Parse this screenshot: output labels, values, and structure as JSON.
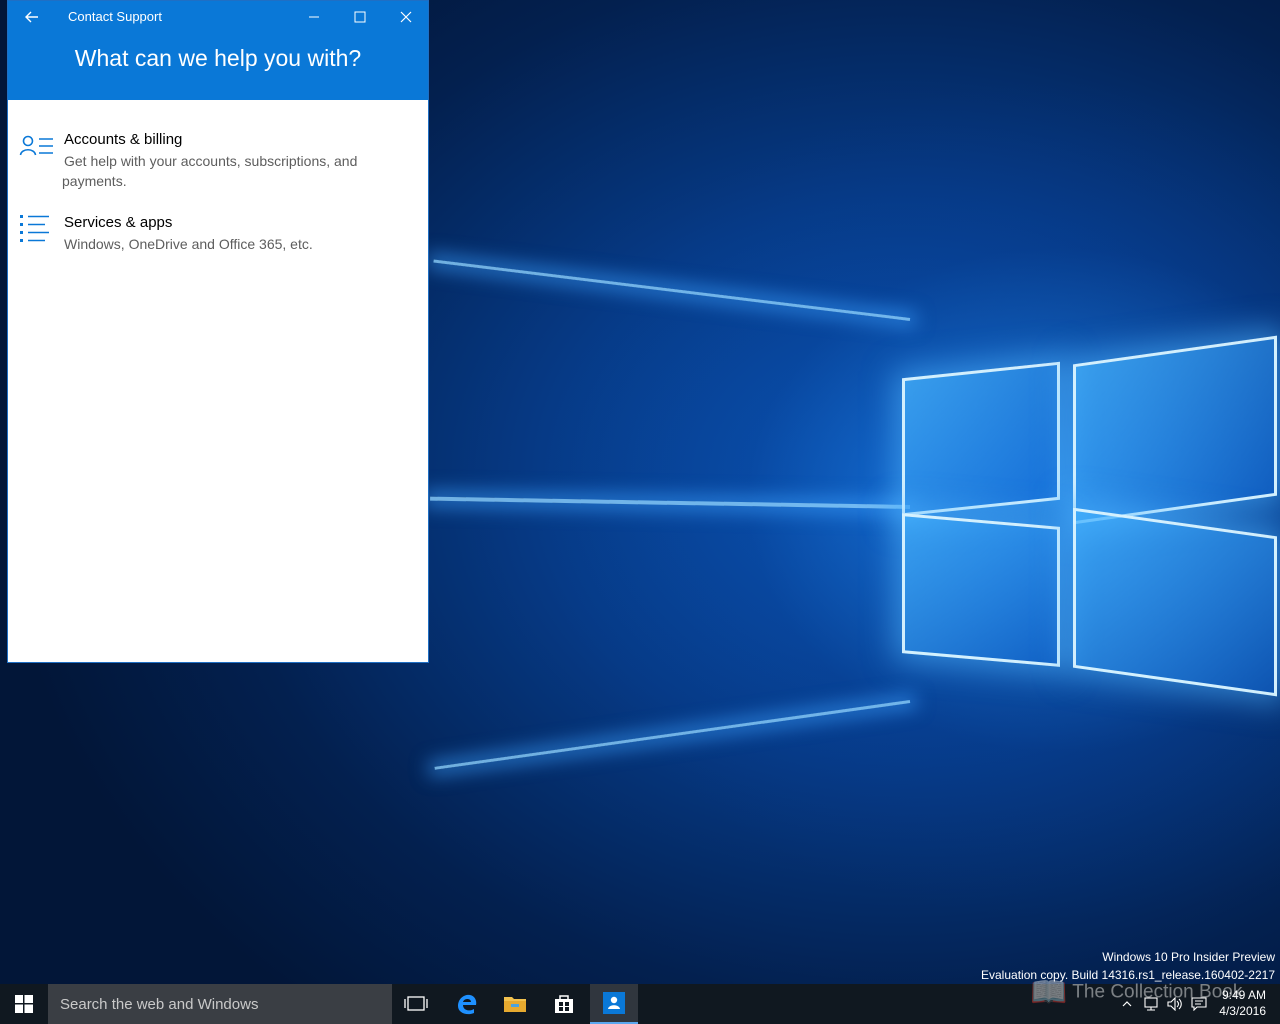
{
  "window": {
    "title": "Contact Support",
    "heading": "What can we help you with?",
    "accent_color": "#0a78d7"
  },
  "options": [
    {
      "title": "Accounts & billing",
      "description": "Get help with your accounts, subscriptions, and payments.",
      "icon": "person-list-icon"
    },
    {
      "title": "Services & apps",
      "description": "Windows, OneDrive and Office 365, etc.",
      "icon": "bullet-list-icon"
    }
  ],
  "desktop": {
    "watermark_line1": "Windows 10 Pro Insider Preview",
    "watermark_line2": "Evaluation copy. Build 14316.rs1_release.160402-2217"
  },
  "taskbar": {
    "search_placeholder": "Search the web and Windows",
    "time": "9:49 AM",
    "date": "4/3/2016",
    "overlay_text": "The Collection Book",
    "pinned": [
      "task-view-icon",
      "edge-icon",
      "file-explorer-icon",
      "store-icon",
      "contact-support-icon"
    ]
  }
}
